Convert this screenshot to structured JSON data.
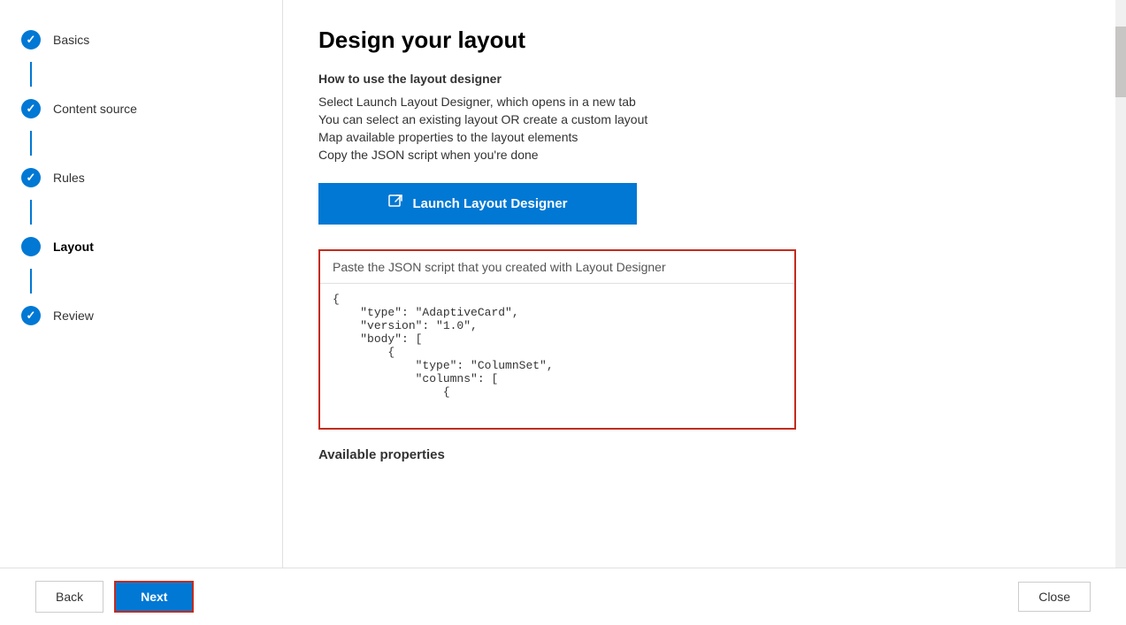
{
  "sidebar": {
    "items": [
      {
        "id": "basics",
        "label": "Basics",
        "state": "completed"
      },
      {
        "id": "content-source",
        "label": "Content source",
        "state": "completed"
      },
      {
        "id": "rules",
        "label": "Rules",
        "state": "completed"
      },
      {
        "id": "layout",
        "label": "Layout",
        "state": "active"
      },
      {
        "id": "review",
        "label": "Review",
        "state": "completed"
      }
    ]
  },
  "page": {
    "title": "Design your layout",
    "subtitle": "How to use the layout designer",
    "instructions": [
      "Select Launch Layout Designer, which opens in a new tab",
      "You can select an existing layout OR create a custom layout",
      "Map available properties to the layout elements",
      "Copy the JSON script when you're done"
    ],
    "launch_button_label": "Launch Layout Designer",
    "json_placeholder": "Paste the JSON script that you created with Layout Designer",
    "json_content": "{\n    \"type\": \"AdaptiveCard\",\n    \"version\": \"1.0\",\n    \"body\": [\n        {\n            \"type\": \"ColumnSet\",\n            \"columns\": [\n                {",
    "available_properties_label": "Available properties"
  },
  "toolbar": {
    "back_label": "Back",
    "next_label": "Next",
    "close_label": "Close"
  },
  "icons": {
    "launch": "⊡",
    "checkmark": "✓"
  }
}
